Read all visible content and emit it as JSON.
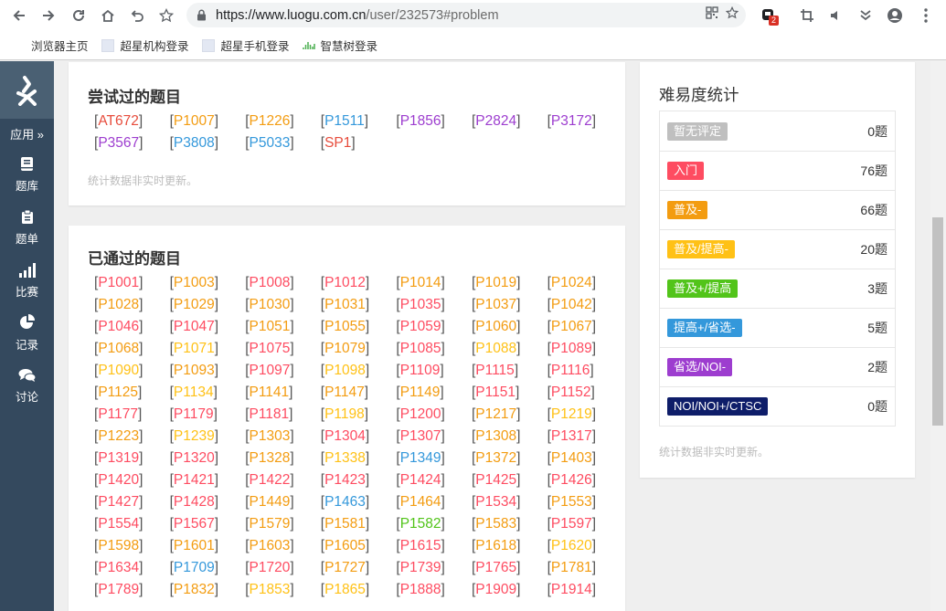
{
  "browser": {
    "url_host": "https://www.luogu.com.cn",
    "url_path": "/user/232573#problem",
    "ext_badge": "2",
    "bookmarks": [
      {
        "label": "浏览器主页"
      },
      {
        "label": "超星机构登录"
      },
      {
        "label": "超星手机登录"
      },
      {
        "label": "智慧树登录"
      }
    ]
  },
  "sidebar": {
    "app_label": "应用 »",
    "items": [
      {
        "label": "题库",
        "icon": "book-icon"
      },
      {
        "label": "题单",
        "icon": "clipboard-icon"
      },
      {
        "label": "比赛",
        "icon": "bar-chart-icon"
      },
      {
        "label": "记录",
        "icon": "pie-chart-icon"
      },
      {
        "label": "讨论",
        "icon": "comments-icon"
      }
    ]
  },
  "attempted": {
    "title": "尝试过的题目",
    "note": "统计数据非实时更新。",
    "problems": [
      {
        "id": "AT672",
        "color": "#e74c3c"
      },
      {
        "id": "P1007",
        "color": "#f39c11"
      },
      {
        "id": "P1226",
        "color": "#f39c11"
      },
      {
        "id": "P1511",
        "color": "#3498db"
      },
      {
        "id": "P1856",
        "color": "#9d3dcf"
      },
      {
        "id": "P2824",
        "color": "#9d3dcf"
      },
      {
        "id": "P3172",
        "color": "#9d3dcf"
      },
      {
        "id": "P3567",
        "color": "#9d3dcf"
      },
      {
        "id": "P3808",
        "color": "#3498db"
      },
      {
        "id": "P5033",
        "color": "#3498db"
      },
      {
        "id": "SP1",
        "color": "#e74c3c"
      }
    ]
  },
  "passed": {
    "title": "已通过的题目",
    "problems": [
      {
        "id": "P1001",
        "color": "#fe4c61"
      },
      {
        "id": "P1003",
        "color": "#f39c11"
      },
      {
        "id": "P1008",
        "color": "#fe4c61"
      },
      {
        "id": "P1012",
        "color": "#fe4c61"
      },
      {
        "id": "P1014",
        "color": "#f39c11"
      },
      {
        "id": "P1019",
        "color": "#f39c11"
      },
      {
        "id": "P1024",
        "color": "#f39c11"
      },
      {
        "id": "P1028",
        "color": "#f39c11"
      },
      {
        "id": "P1029",
        "color": "#f39c11"
      },
      {
        "id": "P1030",
        "color": "#f39c11"
      },
      {
        "id": "P1031",
        "color": "#f39c11"
      },
      {
        "id": "P1035",
        "color": "#fe4c61"
      },
      {
        "id": "P1037",
        "color": "#f39c11"
      },
      {
        "id": "P1042",
        "color": "#f39c11"
      },
      {
        "id": "P1046",
        "color": "#fe4c61"
      },
      {
        "id": "P1047",
        "color": "#fe4c61"
      },
      {
        "id": "P1051",
        "color": "#f39c11"
      },
      {
        "id": "P1055",
        "color": "#f39c11"
      },
      {
        "id": "P1059",
        "color": "#fe4c61"
      },
      {
        "id": "P1060",
        "color": "#f39c11"
      },
      {
        "id": "P1067",
        "color": "#f39c11"
      },
      {
        "id": "P1068",
        "color": "#f39c11"
      },
      {
        "id": "P1071",
        "color": "#ffc116"
      },
      {
        "id": "P1075",
        "color": "#fe4c61"
      },
      {
        "id": "P1079",
        "color": "#f39c11"
      },
      {
        "id": "P1085",
        "color": "#fe4c61"
      },
      {
        "id": "P1088",
        "color": "#ffc116"
      },
      {
        "id": "P1089",
        "color": "#fe4c61"
      },
      {
        "id": "P1090",
        "color": "#ffc116"
      },
      {
        "id": "P1093",
        "color": "#f39c11"
      },
      {
        "id": "P1097",
        "color": "#fe4c61"
      },
      {
        "id": "P1098",
        "color": "#ffc116"
      },
      {
        "id": "P1109",
        "color": "#fe4c61"
      },
      {
        "id": "P1115",
        "color": "#fe4c61"
      },
      {
        "id": "P1116",
        "color": "#fe4c61"
      },
      {
        "id": "P1125",
        "color": "#f39c11"
      },
      {
        "id": "P1134",
        "color": "#ffc116"
      },
      {
        "id": "P1141",
        "color": "#f39c11"
      },
      {
        "id": "P1147",
        "color": "#f39c11"
      },
      {
        "id": "P1149",
        "color": "#f39c11"
      },
      {
        "id": "P1151",
        "color": "#fe4c61"
      },
      {
        "id": "P1152",
        "color": "#fe4c61"
      },
      {
        "id": "P1177",
        "color": "#fe4c61"
      },
      {
        "id": "P1179",
        "color": "#fe4c61"
      },
      {
        "id": "P1181",
        "color": "#fe4c61"
      },
      {
        "id": "P1198",
        "color": "#ffc116"
      },
      {
        "id": "P1200",
        "color": "#fe4c61"
      },
      {
        "id": "P1217",
        "color": "#f39c11"
      },
      {
        "id": "P1219",
        "color": "#ffc116"
      },
      {
        "id": "P1223",
        "color": "#f39c11"
      },
      {
        "id": "P1239",
        "color": "#ffc116"
      },
      {
        "id": "P1303",
        "color": "#f39c11"
      },
      {
        "id": "P1304",
        "color": "#fe4c61"
      },
      {
        "id": "P1307",
        "color": "#fe4c61"
      },
      {
        "id": "P1308",
        "color": "#f39c11"
      },
      {
        "id": "P1317",
        "color": "#fe4c61"
      },
      {
        "id": "P1319",
        "color": "#fe4c61"
      },
      {
        "id": "P1320",
        "color": "#fe4c61"
      },
      {
        "id": "P1328",
        "color": "#f39c11"
      },
      {
        "id": "P1338",
        "color": "#ffc116"
      },
      {
        "id": "P1349",
        "color": "#3498db"
      },
      {
        "id": "P1372",
        "color": "#f39c11"
      },
      {
        "id": "P1403",
        "color": "#f39c11"
      },
      {
        "id": "P1420",
        "color": "#fe4c61"
      },
      {
        "id": "P1421",
        "color": "#fe4c61"
      },
      {
        "id": "P1422",
        "color": "#fe4c61"
      },
      {
        "id": "P1423",
        "color": "#fe4c61"
      },
      {
        "id": "P1424",
        "color": "#fe4c61"
      },
      {
        "id": "P1425",
        "color": "#fe4c61"
      },
      {
        "id": "P1426",
        "color": "#fe4c61"
      },
      {
        "id": "P1427",
        "color": "#fe4c61"
      },
      {
        "id": "P1428",
        "color": "#fe4c61"
      },
      {
        "id": "P1449",
        "color": "#f39c11"
      },
      {
        "id": "P1463",
        "color": "#3498db"
      },
      {
        "id": "P1464",
        "color": "#f39c11"
      },
      {
        "id": "P1534",
        "color": "#fe4c61"
      },
      {
        "id": "P1553",
        "color": "#f39c11"
      },
      {
        "id": "P1554",
        "color": "#fe4c61"
      },
      {
        "id": "P1567",
        "color": "#fe4c61"
      },
      {
        "id": "P1579",
        "color": "#f39c11"
      },
      {
        "id": "P1581",
        "color": "#f39c11"
      },
      {
        "id": "P1582",
        "color": "#52c41a"
      },
      {
        "id": "P1583",
        "color": "#f39c11"
      },
      {
        "id": "P1597",
        "color": "#fe4c61"
      },
      {
        "id": "P1598",
        "color": "#f39c11"
      },
      {
        "id": "P1601",
        "color": "#f39c11"
      },
      {
        "id": "P1603",
        "color": "#f39c11"
      },
      {
        "id": "P1605",
        "color": "#f39c11"
      },
      {
        "id": "P1615",
        "color": "#fe4c61"
      },
      {
        "id": "P1618",
        "color": "#f39c11"
      },
      {
        "id": "P1620",
        "color": "#ffc116"
      },
      {
        "id": "P1634",
        "color": "#fe4c61"
      },
      {
        "id": "P1709",
        "color": "#3498db"
      },
      {
        "id": "P1720",
        "color": "#fe4c61"
      },
      {
        "id": "P1727",
        "color": "#f39c11"
      },
      {
        "id": "P1739",
        "color": "#fe4c61"
      },
      {
        "id": "P1765",
        "color": "#fe4c61"
      },
      {
        "id": "P1781",
        "color": "#f39c11"
      },
      {
        "id": "P1789",
        "color": "#fe4c61"
      },
      {
        "id": "P1832",
        "color": "#f39c11"
      },
      {
        "id": "P1853",
        "color": "#ffc116"
      },
      {
        "id": "P1865",
        "color": "#ffc116"
      },
      {
        "id": "P1888",
        "color": "#fe4c61"
      },
      {
        "id": "P1909",
        "color": "#fe4c61"
      },
      {
        "id": "P1914",
        "color": "#fe4c61"
      }
    ]
  },
  "difficulty": {
    "title": "难易度统计",
    "note": "统计数据非实时更新。",
    "rows": [
      {
        "label": "暂无评定",
        "color": "#bfbfbf",
        "count": "0题"
      },
      {
        "label": "入门",
        "color": "#fe4c61",
        "count": "76题"
      },
      {
        "label": "普及-",
        "color": "#f39c11",
        "count": "66题"
      },
      {
        "label": "普及/提高-",
        "color": "#ffc116",
        "count": "20题"
      },
      {
        "label": "普及+/提高",
        "color": "#52c41a",
        "count": "3题"
      },
      {
        "label": "提高+/省选-",
        "color": "#3498db",
        "count": "5题"
      },
      {
        "label": "省选/NOI-",
        "color": "#9d3dcf",
        "count": "2题"
      },
      {
        "label": "NOI/NOI+/CTSC",
        "color": "#0e1d69",
        "count": "0题"
      }
    ]
  }
}
